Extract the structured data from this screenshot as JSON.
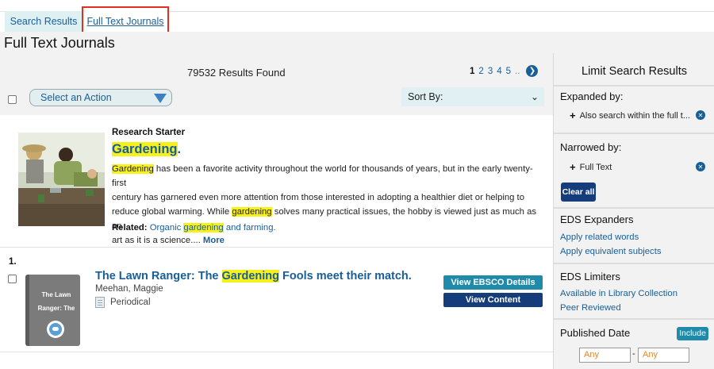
{
  "tabs": {
    "search_results": "Search Results",
    "full_text_journals": "Full Text Journals"
  },
  "page_title": "Full Text Journals",
  "results": {
    "count_text": "79532 Results Found",
    "pages": [
      "1",
      "2",
      "3",
      "4",
      "5",
      ".."
    ],
    "current_page": "1",
    "action_select": "Select an Action",
    "sort_by": "Sort By:"
  },
  "research_starter": {
    "kind": "Research Starter",
    "title": "Gardening",
    "title_suffix": ".",
    "text_line1_hl": "Gardening",
    "text_line1": " has been a favorite activity throughout the world for thousands of years, but in the early twenty-first",
    "text_line2": "century has garnered even more attention from those interested in adopting a healthier diet or helping to",
    "text_line3_a": "reduce global warming. While ",
    "text_line3_hl": "gardening",
    "text_line3_b": " solves many practical issues, the hobby is viewed just as much as an",
    "text_line4": "art as it is a science.... ",
    "more": "More",
    "related_label": "Related:",
    "related_a": "Organic ",
    "related_hl": "gardening",
    "related_b": " and farming."
  },
  "result1": {
    "number": "1.",
    "book_title": "The Lawn Ranger: The",
    "title_a": "The Lawn Ranger: The ",
    "title_hl": "Gardening",
    "title_b": " Fools meet their match.",
    "author": "Meehan, Maggie",
    "type": "Periodical",
    "view_details": "View EBSCO Details",
    "view_content": "View Content"
  },
  "sidebar": {
    "title": "Limit Search Results",
    "expanded_by": "Expanded by:",
    "expanded_item": "Also search within the full t...",
    "narrowed_by": "Narrowed by:",
    "narrowed_item": "Full Text",
    "clear_all": "Clear all",
    "eds_expanders": "EDS Expanders",
    "expander_1": "Apply related words",
    "expander_2": "Apply equivalent subjects",
    "eds_limiters": "EDS Limiters",
    "limiter_1": "Available in Library Collection",
    "limiter_2": "Peer Reviewed",
    "published_date": "Published Date",
    "include": "Include",
    "date_from": "Any",
    "date_to": "Any"
  },
  "colors": {
    "link": "#1a5e97",
    "highlight": "#f6f01d",
    "tab_active_border": "#e2301e",
    "panel_bg": "#f2f2f2"
  }
}
